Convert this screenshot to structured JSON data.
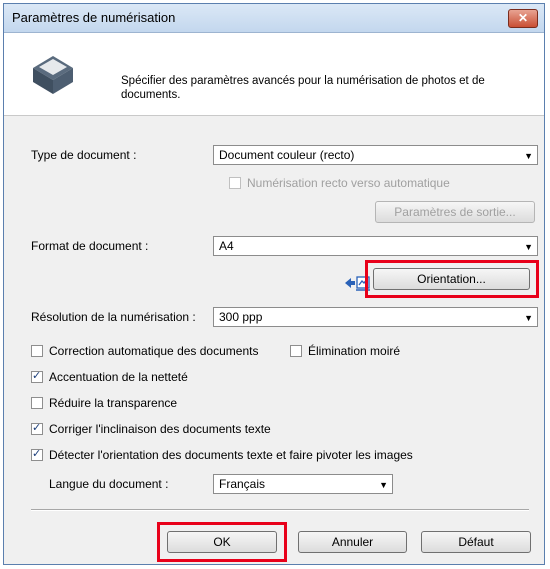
{
  "window": {
    "title": "Paramètres de numérisation",
    "close_glyph": "✕",
    "description": "Spécifier des paramètres avancés pour la numérisation de photos et de documents."
  },
  "document_type": {
    "label": "Type de document :",
    "value": "Document couleur (recto)",
    "duplex_label": "Numérisation recto verso automatique",
    "duplex_checked": false,
    "duplex_enabled": false,
    "output_settings_label": "Paramètres de sortie..."
  },
  "document_size": {
    "label": "Format de document :",
    "value": "A4",
    "orientation_icon": "rotate-page-icon",
    "orientation_button": "Orientation..."
  },
  "resolution": {
    "label": "Résolution de la numérisation :",
    "value": "300 ppp"
  },
  "options": {
    "auto_correction": {
      "label": "Correction automatique des documents",
      "checked": false
    },
    "moire": {
      "label": "Élimination moiré",
      "checked": false
    },
    "sharpen": {
      "label": "Accentuation de la netteté",
      "checked": true
    },
    "show_through": {
      "label": "Réduire la transparence",
      "checked": false
    },
    "skew": {
      "label": "Corriger l'inclinaison des documents texte",
      "checked": true
    },
    "detect_orientation": {
      "label": "Détecter l'orientation des documents texte et faire pivoter les images",
      "checked": true
    }
  },
  "language": {
    "label": "Langue du document :",
    "value": "Français"
  },
  "footer": {
    "ok": "OK",
    "cancel": "Annuler",
    "default": "Défaut"
  },
  "colors": {
    "highlight": "#e8001a",
    "title_bar": "#c3d7ee",
    "dialog_bg": "#f0f0f0"
  }
}
